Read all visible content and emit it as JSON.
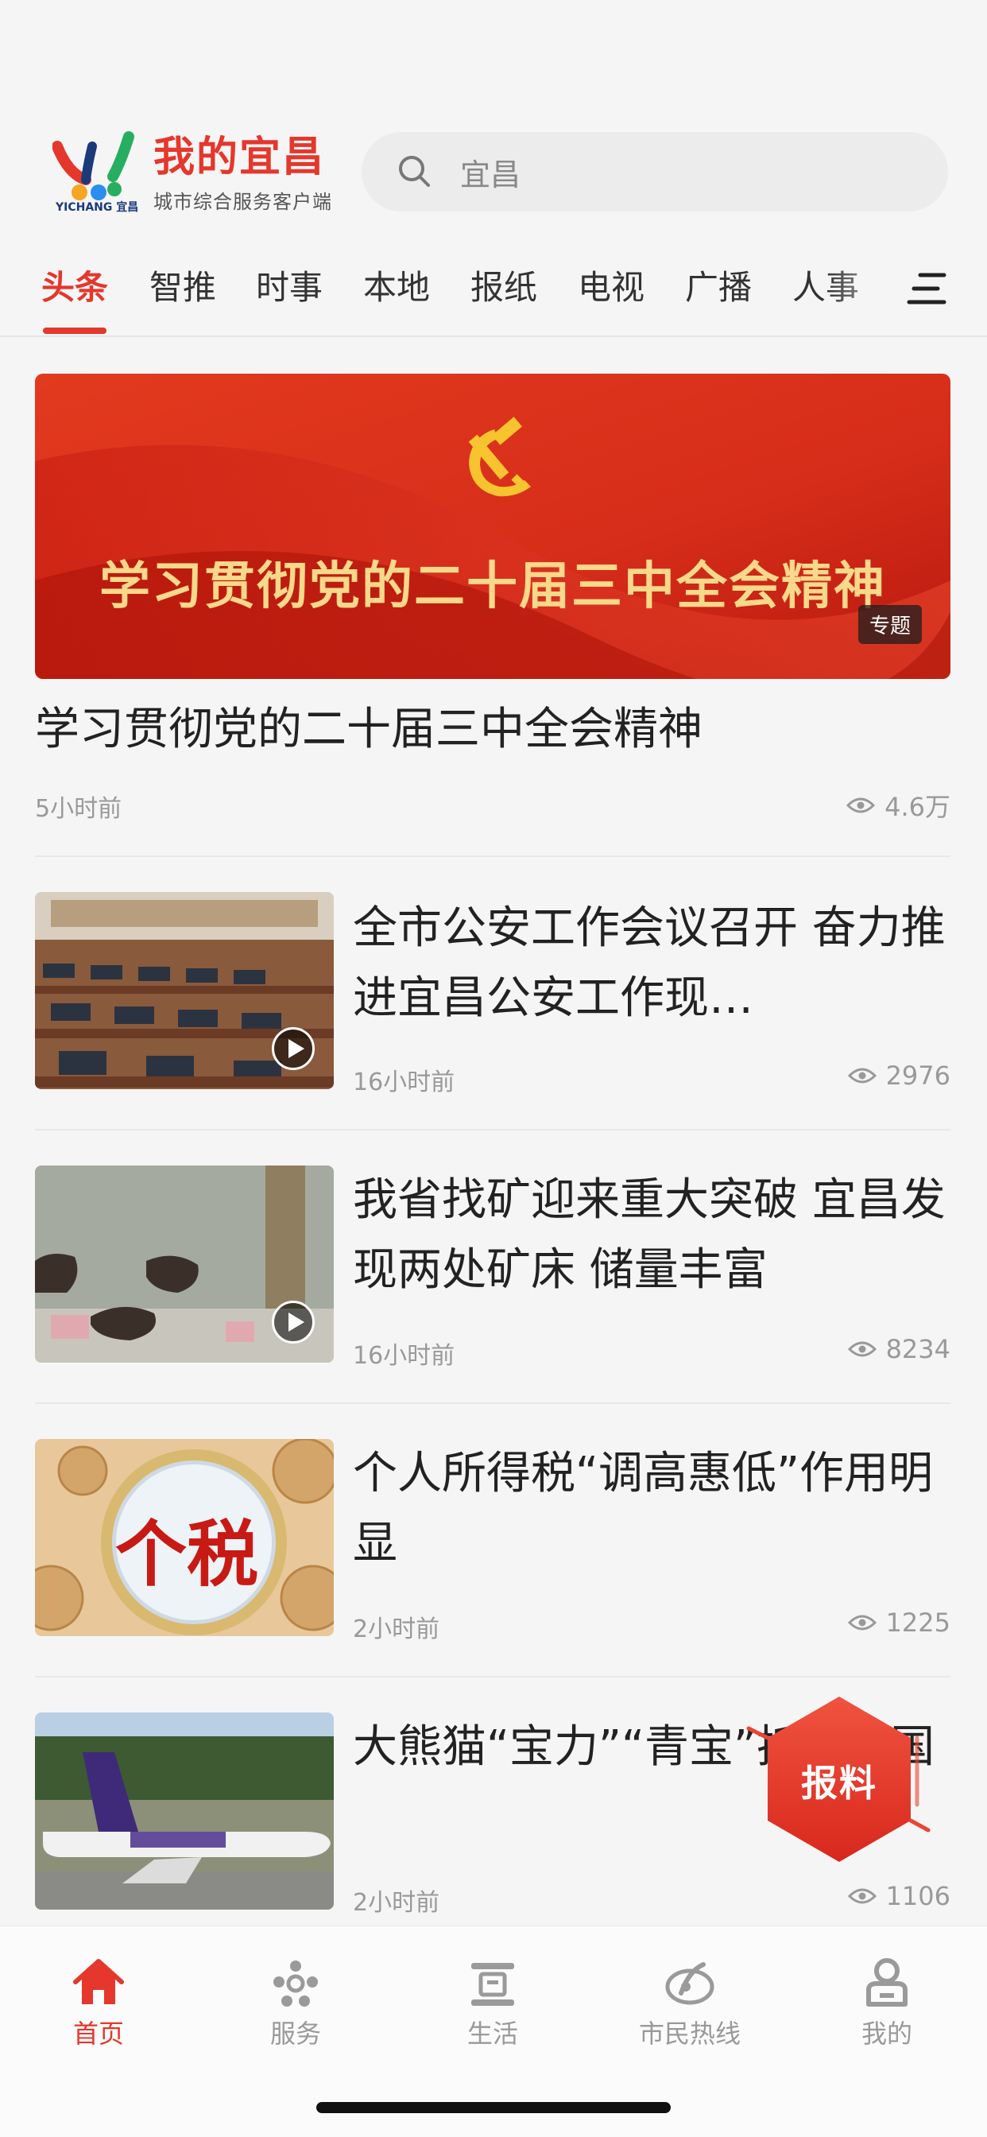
{
  "header": {
    "brand_title": "我的宜昌",
    "brand_subtitle": "城市综合服务客户端",
    "logo_caption": "YICHANG 宜昌",
    "search_placeholder": "宜昌"
  },
  "tabs": [
    {
      "label": "头条",
      "active": true
    },
    {
      "label": "智推"
    },
    {
      "label": "时事"
    },
    {
      "label": "本地"
    },
    {
      "label": "报纸"
    },
    {
      "label": "电视"
    },
    {
      "label": "广播"
    },
    {
      "label": "人事"
    }
  ],
  "feature": {
    "banner_text": "学习贯彻党的二十届三中全会精神",
    "tag": "专题",
    "title": "学习贯彻党的二十届三中全会精神",
    "time": "5小时前",
    "views": "4.6万"
  },
  "news": [
    {
      "title": "全市公安工作会议召开 奋力推进宜昌公安工作现…",
      "time": "16小时前",
      "views": "2976",
      "video": true
    },
    {
      "title": "我省找矿迎来重大突破 宜昌发现两处矿床 储量丰富",
      "time": "16小时前",
      "views": "8234",
      "video": true
    },
    {
      "title": "个人所得税“调高惠低”作用明显",
      "time": "2小时前",
      "views": "1225",
      "thumb_text": "个税"
    },
    {
      "title": "大熊猫“宝力”“青宝”抵达美国",
      "time": "2小时前",
      "views": "1106"
    }
  ],
  "float_button": {
    "label": "报料"
  },
  "bottom_nav": [
    {
      "label": "首页",
      "icon": "home-icon",
      "active": true
    },
    {
      "label": "服务",
      "icon": "service-icon"
    },
    {
      "label": "生活",
      "icon": "life-icon"
    },
    {
      "label": "市民热线",
      "icon": "hotline-icon"
    },
    {
      "label": "我的",
      "icon": "profile-icon"
    }
  ],
  "colors": {
    "accent": "#e5372b",
    "text": "#222222",
    "muted": "#999999"
  }
}
